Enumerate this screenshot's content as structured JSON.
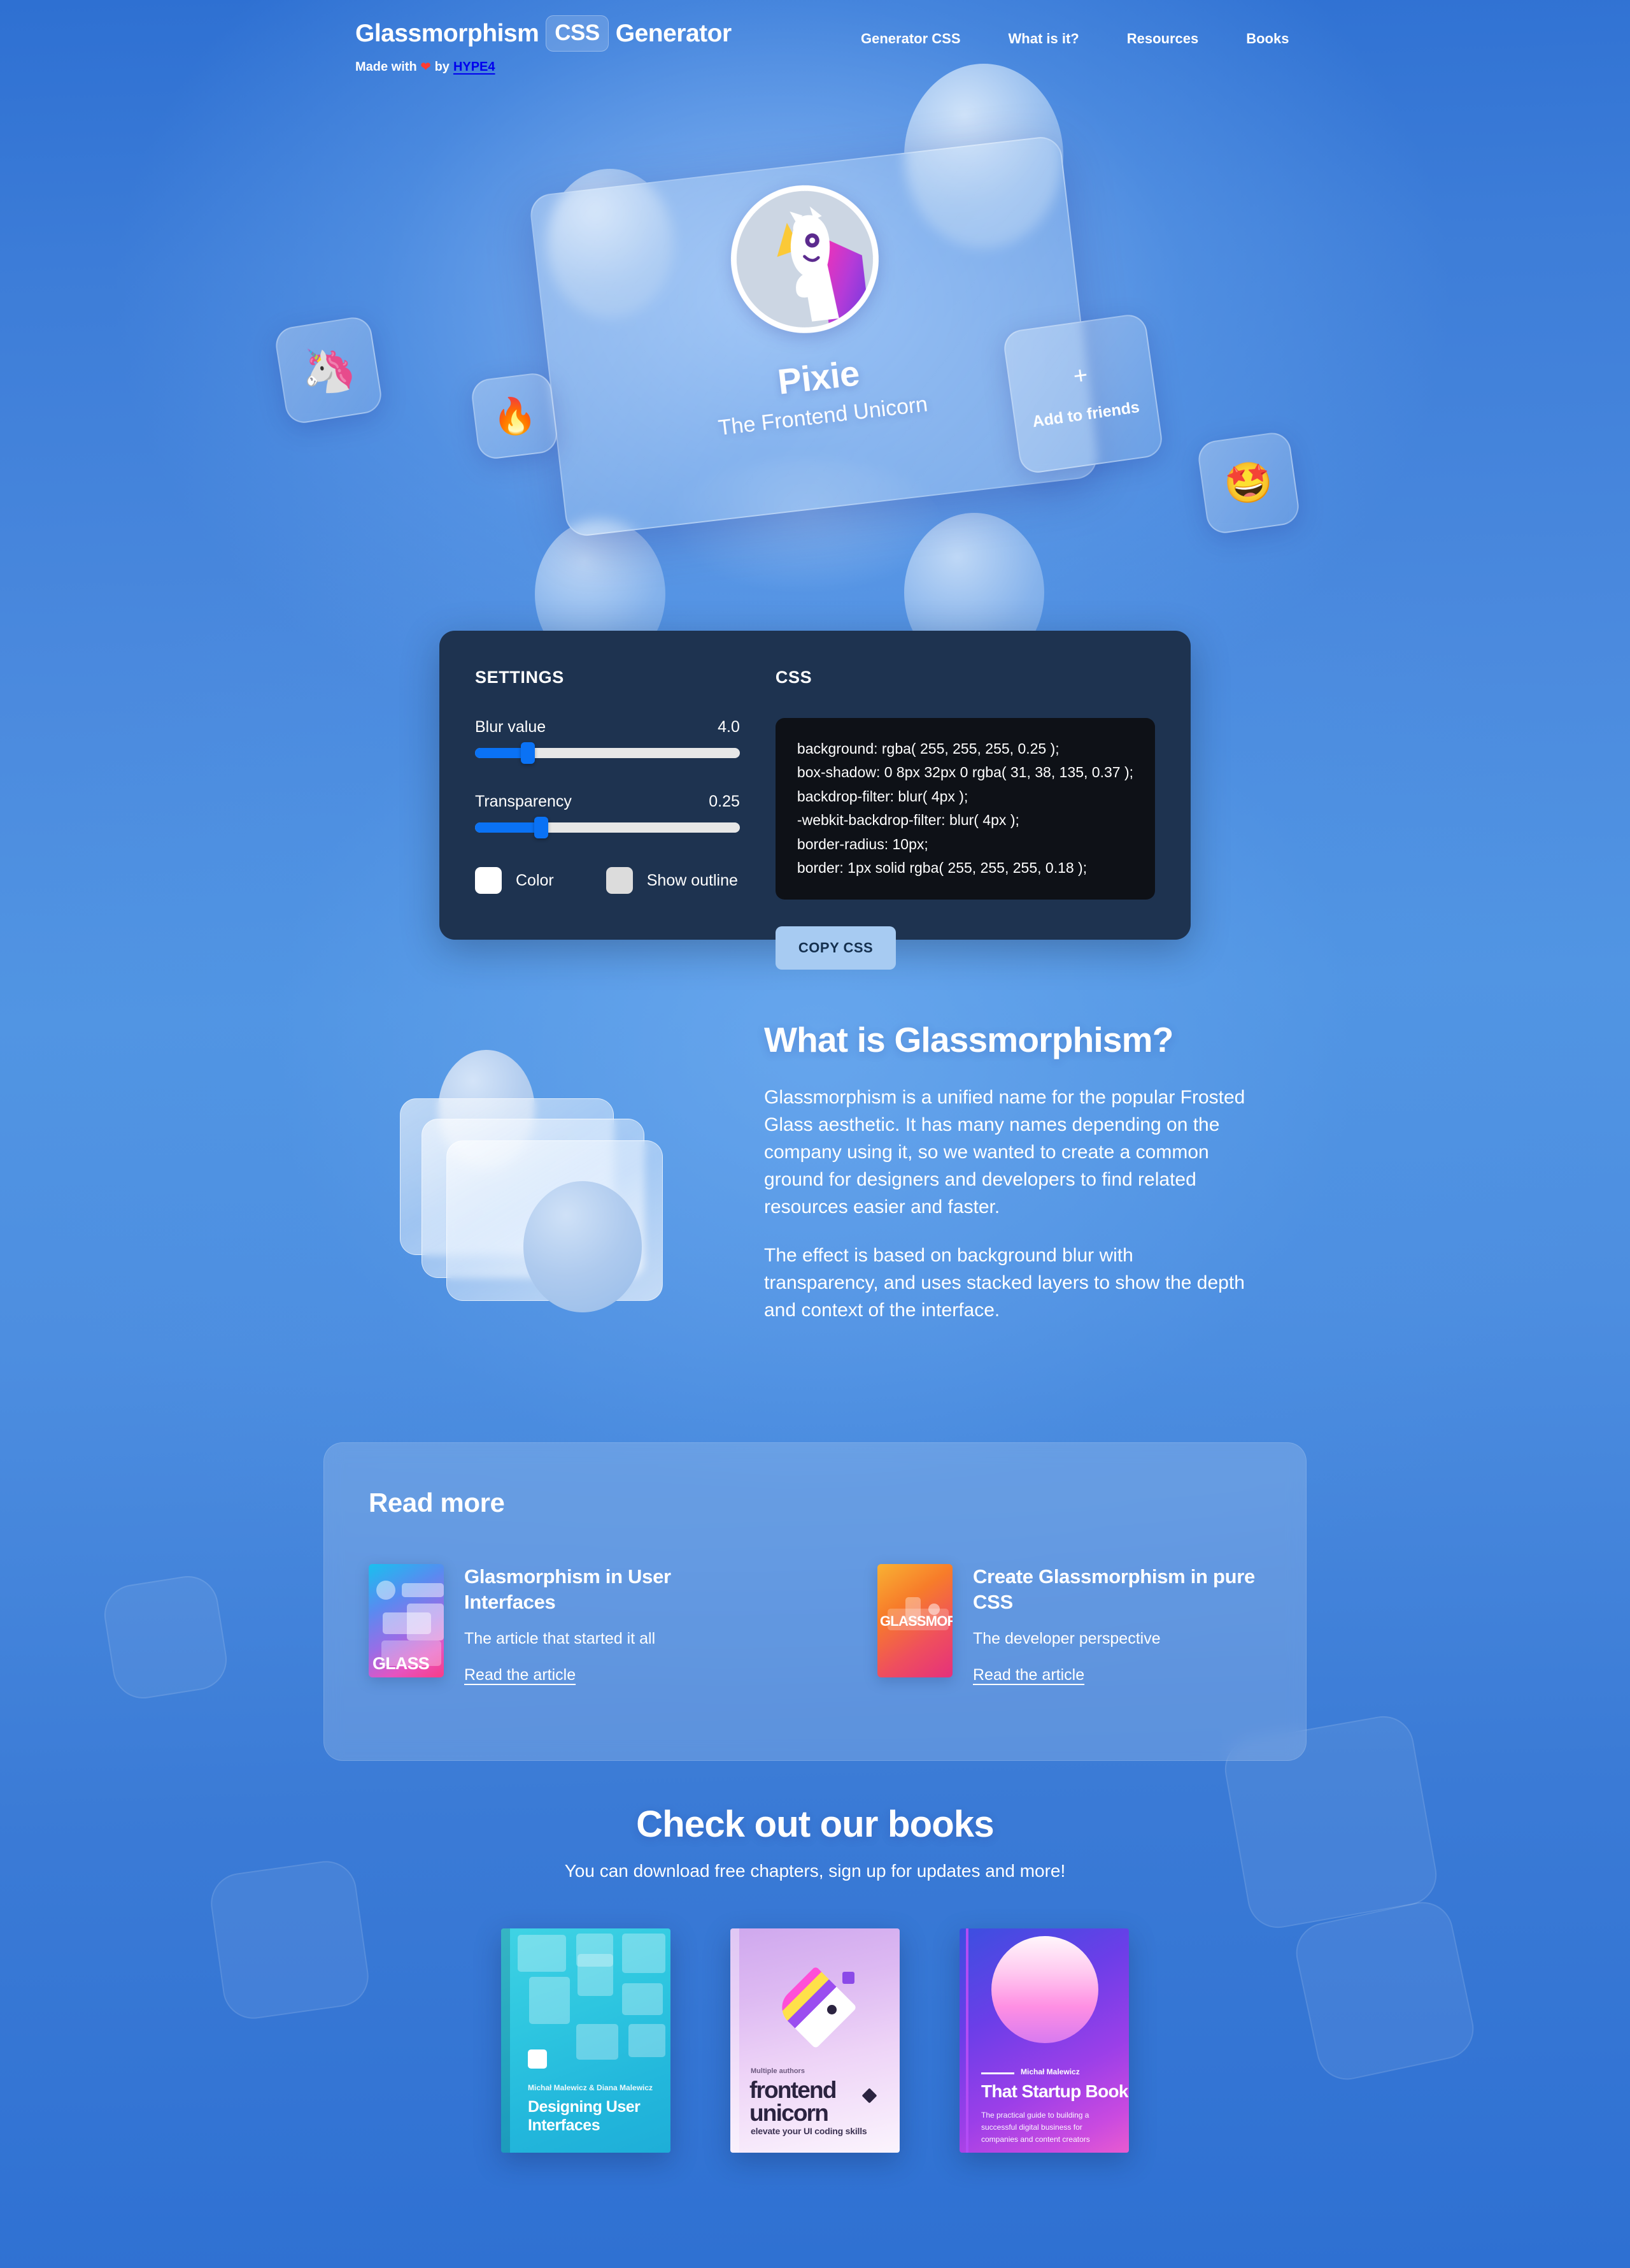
{
  "header": {
    "brand": {
      "word1": "Glassmorphism",
      "chip": "CSS",
      "word2": "Generator",
      "made_with": "Made with",
      "heart": "❤",
      "by": "by",
      "author": "HYPE4"
    },
    "nav": [
      {
        "label": "Generator CSS"
      },
      {
        "label": "What is it?"
      },
      {
        "label": "Resources"
      },
      {
        "label": "Books"
      }
    ]
  },
  "hero": {
    "profile_name": "Pixie",
    "profile_tagline": "The Frontend Unicorn",
    "add_friends_plus": "+",
    "add_friends_label": "Add to friends",
    "tile_unicorn_emoji": "🦄",
    "tile_fire_emoji": "🔥",
    "tile_star_emoji": "🤩"
  },
  "settings": {
    "heading": "SETTINGS",
    "blur_label": "Blur value",
    "blur_value": "4.0",
    "blur_percent": 20,
    "transparency_label": "Transparency",
    "transparency_value": "0.25",
    "transparency_percent": 25,
    "color_label": "Color",
    "color_swatch": "#ffffff",
    "outline_label": "Show outline",
    "outline_swatch": "#dcdcdc"
  },
  "css_output": {
    "heading": "CSS",
    "lines": [
      "background: rgba( 255, 255, 255, 0.25 );",
      "box-shadow: 0 8px 32px 0 rgba( 31, 38, 135, 0.37 );",
      "backdrop-filter: blur( 4px );",
      "-webkit-backdrop-filter: blur( 4px );",
      "border-radius: 10px;",
      "border: 1px solid rgba( 255, 255, 255, 0.18 );"
    ],
    "copy_button": "COPY CSS"
  },
  "what_is": {
    "title": "What is Glassmorphism?",
    "paragraph1": "Glassmorphism is a unified name for the popular Frosted Glass aesthetic. It has many names depending on the company using it, so we wanted to create a common ground for designers and developers to find related resources easier and faster.",
    "paragraph2": "The effect is based on background blur with transparency, and uses stacked layers to show the depth and context of the interface."
  },
  "read_more": {
    "title": "Read more",
    "articles": [
      {
        "thumb_word": "GLASS",
        "title": "Glasmorphism in User Interfaces",
        "description": "The article that started it all",
        "link": "Read the article"
      },
      {
        "thumb_word": "GLASSMORP",
        "title": "Create Glassmorphism in pure CSS",
        "description": "The developer perspective",
        "link": "Read the article"
      }
    ]
  },
  "books": {
    "title": "Check out our books",
    "subtitle": "You can download free chapters, sign up for updates and more!",
    "items": [
      {
        "author": "Michał Malewicz & Diana Malewicz",
        "name": "Designing User Interfaces",
        "tagline": ""
      },
      {
        "author": "Multiple authors",
        "name": "frontend unicorn",
        "tagline": "elevate your UI coding skills"
      },
      {
        "author": "Michał Malewicz",
        "name": "That Startup Book",
        "tagline": "The practical guide to building a successful digital business for companies and content creators"
      }
    ]
  },
  "colors": {
    "background_top": "#2e70d2",
    "background_mid": "#5195e3",
    "panel_dark": "#1e3350",
    "code_bg": "#0e1117",
    "slider_accent": "#0a72f5",
    "copy_button_bg": "#a7cbf2"
  }
}
